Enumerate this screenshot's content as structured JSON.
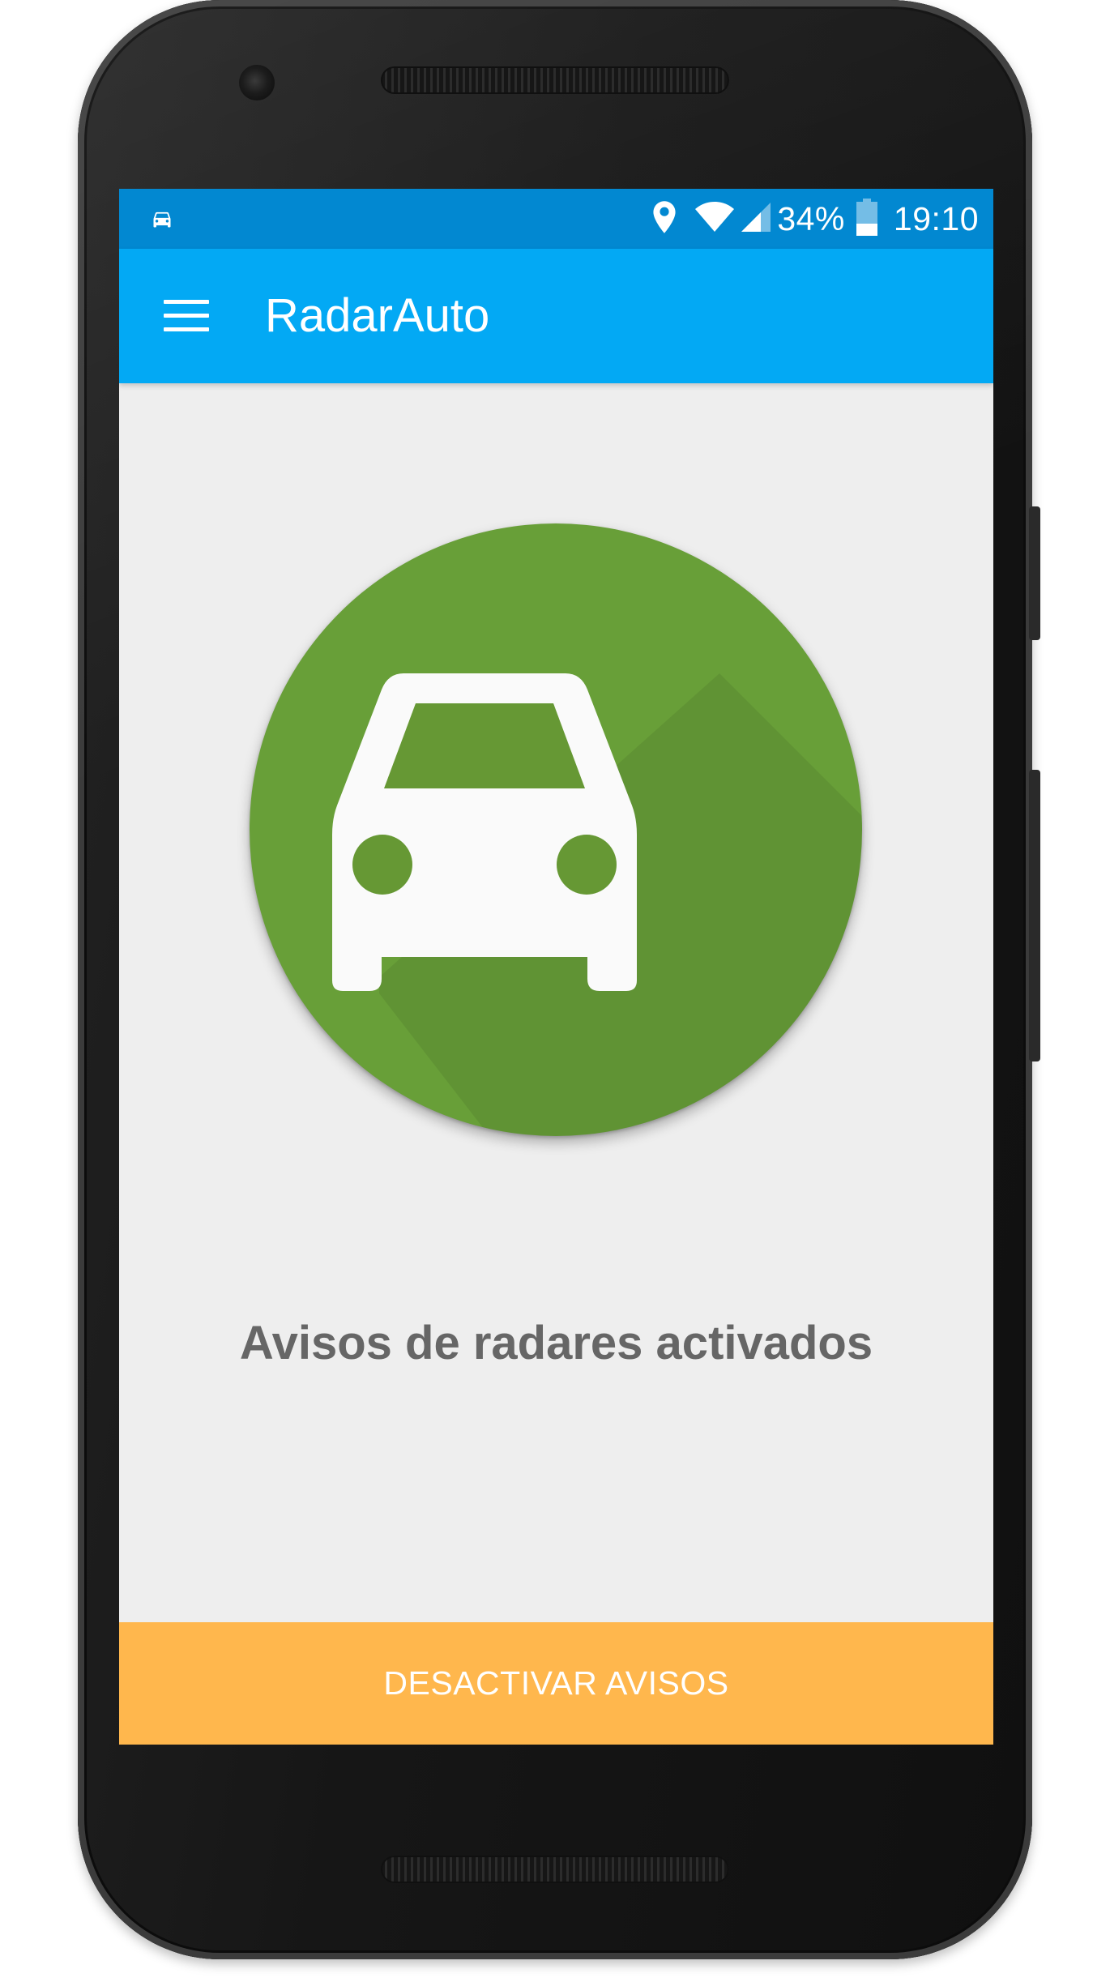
{
  "status_bar": {
    "left_icon": "car-notification-icon",
    "right_icons": [
      "location-icon",
      "wifi-icon",
      "cell-signal-icon",
      "battery-icon"
    ],
    "battery_percent": "34%",
    "time": "19:10"
  },
  "app_bar": {
    "menu_icon": "hamburger-menu-icon",
    "title": "RadarAuto"
  },
  "main": {
    "status_icon": "car-icon",
    "status_message": "Avisos de radares activados"
  },
  "action": {
    "label": "DESACTIVAR AVISOS"
  },
  "colors": {
    "status_bar": "#0288d1",
    "app_bar": "#03a9f4",
    "status_circle": "#689f38",
    "action_button": "#ffb74d",
    "background": "#eeeeee",
    "message_text": "#666666"
  }
}
